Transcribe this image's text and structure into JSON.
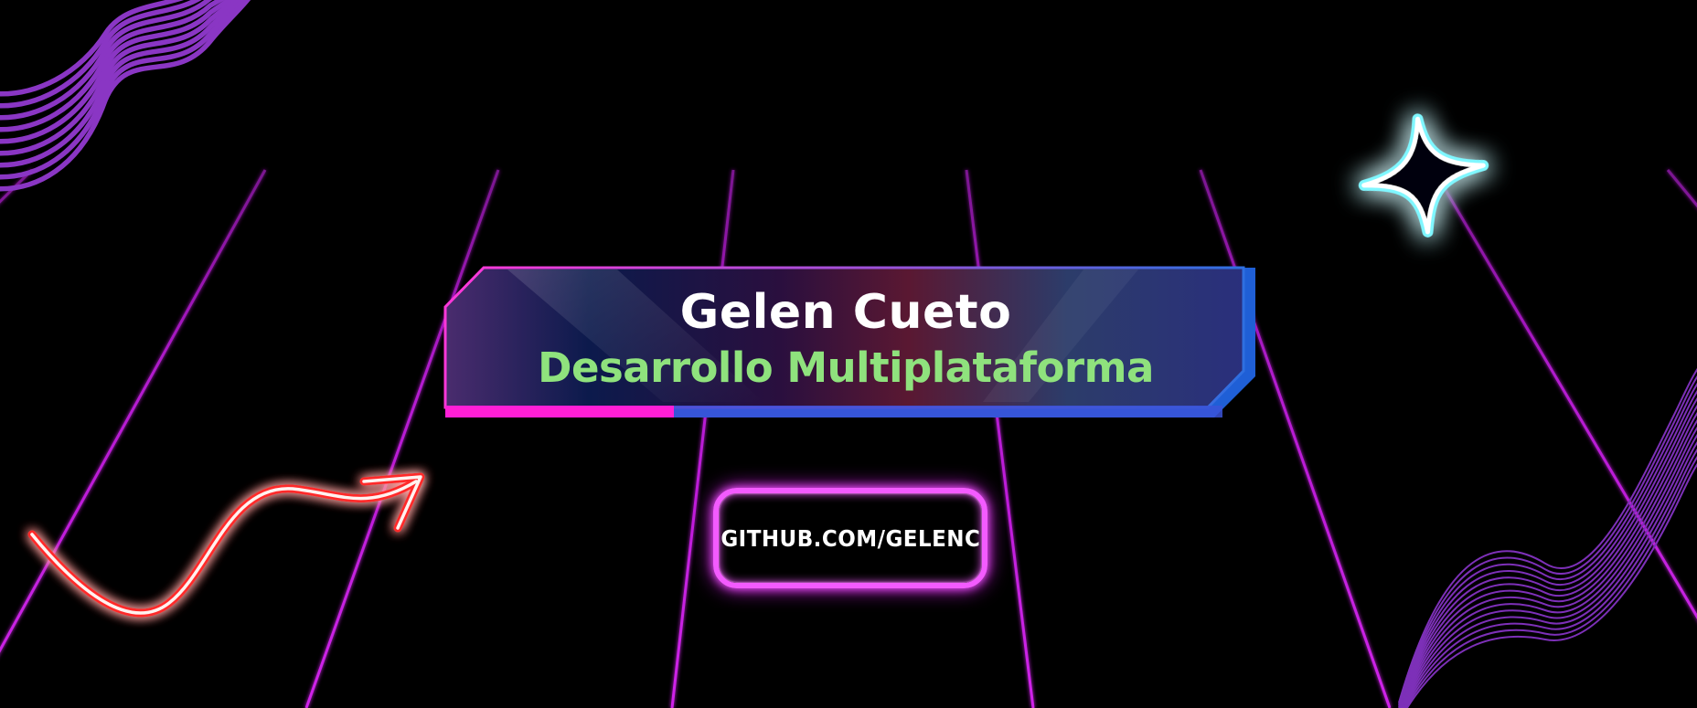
{
  "banner": {
    "name": "Gelen Cueto",
    "subtitle": "Desarrollo Multiplataforma"
  },
  "link": {
    "label": "GITHUB.COM/GELENC"
  },
  "colors": {
    "background": "#000000",
    "grid": "#c21cd8",
    "name_text": "#ffffff",
    "subtitle_text": "#8fe27d",
    "button_border": "#f35bff",
    "arrow_glow": "#ff2a2a",
    "sparkle_glow": "#6ff4ff",
    "waves": "#8a36c4",
    "banner_border_left": "#ff38d9",
    "banner_border_right": "#2e6fe0"
  },
  "icons": {
    "arrow": "squiggle-arrow-icon",
    "sparkle": "sparkle-star-icon"
  }
}
